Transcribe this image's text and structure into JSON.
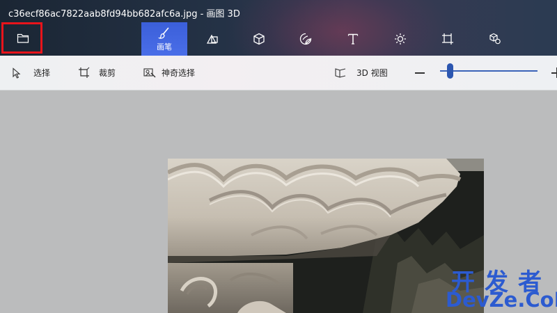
{
  "window": {
    "title": "c36ecf86ac7822aab8fd94bb682afc6a.jpg - 画图 3D"
  },
  "header": {
    "menu_icon": "folder-icon",
    "tools": [
      {
        "id": "brushes",
        "icon": "brush-icon",
        "label": "画笔",
        "active": true
      },
      {
        "id": "2d-shapes",
        "icon": "2d-shapes-icon",
        "label": "",
        "active": false
      },
      {
        "id": "3d-shapes",
        "icon": "cube-icon",
        "label": "",
        "active": false
      },
      {
        "id": "stickers",
        "icon": "sticker-icon",
        "label": "",
        "active": false
      },
      {
        "id": "text",
        "icon": "text-icon",
        "label": "",
        "active": false
      },
      {
        "id": "effects",
        "icon": "sun-icon",
        "label": "",
        "active": false
      },
      {
        "id": "canvas",
        "icon": "crop-canvas-icon",
        "label": "",
        "active": false
      },
      {
        "id": "3d-library",
        "icon": "3d-library-icon",
        "label": "",
        "active": false
      }
    ],
    "accent_color": "#3b5fd9",
    "highlight_color": "#e8141b"
  },
  "subbar": {
    "select_label": "选择",
    "crop_label": "裁剪",
    "magic_select_label": "神奇选择",
    "view3d_label": "3D 视图",
    "zoom_level": 0.1
  },
  "watermark": {
    "cn": "开发者",
    "en": "DevZe.CoM"
  }
}
